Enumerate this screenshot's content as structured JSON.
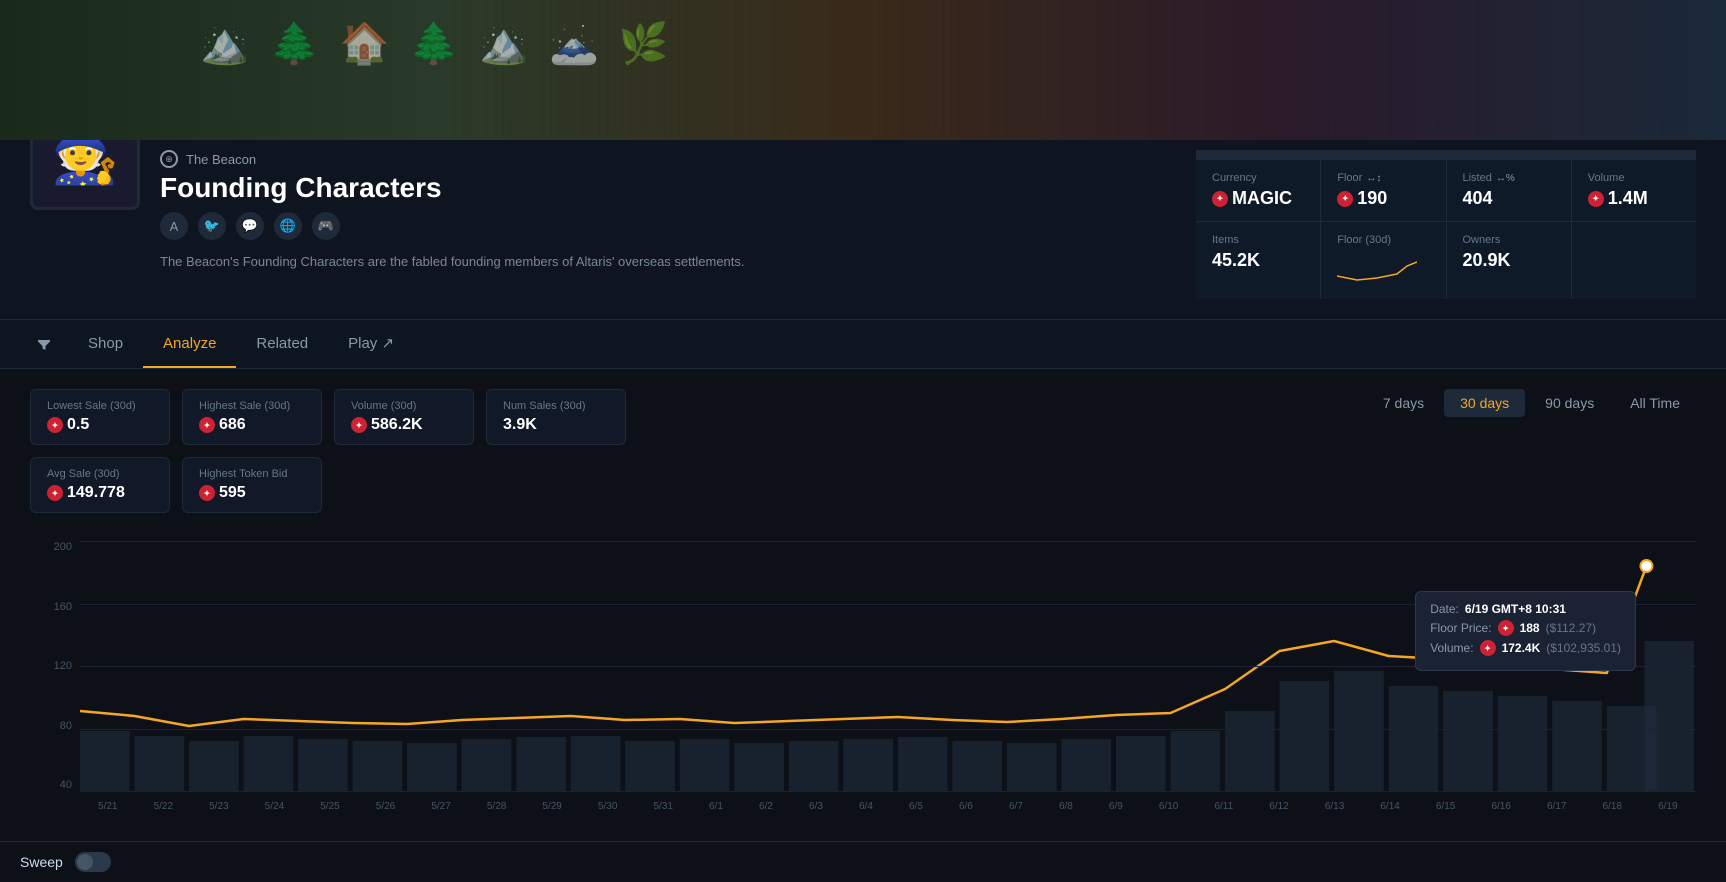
{
  "banner": {
    "emoji": "🏔️"
  },
  "collection": {
    "avatar_emoji": "🧙",
    "brand": "The Beacon",
    "title": "Founding Characters",
    "description": "The Beacon's Founding Characters are the fabled founding members of Altaris' overseas settlements.",
    "social_links": [
      "A",
      "🐦",
      "💬",
      "🌐",
      "🎮"
    ]
  },
  "stats": {
    "currency": {
      "label": "Currency",
      "value": "MAGIC"
    },
    "floor": {
      "label": "Floor",
      "value": "190",
      "arrows": "↔↕"
    },
    "listed": {
      "label": "Listed",
      "value": "404",
      "arrows": "↔%"
    },
    "volume": {
      "label": "Volume",
      "value": "1.4M"
    },
    "items": {
      "label": "Items",
      "value": "45.2K"
    },
    "floor_30d": {
      "label": "Floor (30d)"
    },
    "owners": {
      "label": "Owners",
      "value": "20.9K"
    }
  },
  "nav": {
    "filter_icon": "▼",
    "tabs": [
      {
        "label": "Shop",
        "active": false
      },
      {
        "label": "Analyze",
        "active": true
      },
      {
        "label": "Related",
        "active": false
      },
      {
        "label": "Play ↗",
        "active": false,
        "external": true
      }
    ]
  },
  "analyze": {
    "stats": [
      {
        "label": "Lowest Sale (30d)",
        "value": "0.5"
      },
      {
        "label": "Highest Sale (30d)",
        "value": "686"
      },
      {
        "label": "Volume (30d)",
        "value": "586.2K"
      },
      {
        "label": "Num Sales (30d)",
        "value": "3.9K"
      },
      {
        "label": "Avg Sale (30d)",
        "value": "149.778"
      },
      {
        "label": "Highest Token Bid",
        "value": "595"
      }
    ],
    "time_buttons": [
      {
        "label": "7 days",
        "active": false
      },
      {
        "label": "30 days",
        "active": true
      },
      {
        "label": "90 days",
        "active": false
      },
      {
        "label": "All Time",
        "active": false
      }
    ],
    "chart": {
      "y_labels": [
        "200",
        "160",
        "120",
        "80",
        "40"
      ],
      "x_labels": [
        "5/21",
        "5/22",
        "5/23",
        "5/24",
        "5/25",
        "5/26",
        "5/27",
        "5/28",
        "5/29",
        "5/30",
        "5/31",
        "6/1",
        "6/2",
        "6/3",
        "6/4",
        "6/5",
        "6/6",
        "6/7",
        "6/8",
        "6/9",
        "6/10",
        "6/11",
        "6/12",
        "6/13",
        "6/14",
        "6/15",
        "6/16",
        "6/17",
        "6/18",
        "6/19"
      ],
      "bars": [
        20,
        18,
        15,
        17,
        16,
        14,
        13,
        15,
        16,
        17,
        14,
        15,
        13,
        14,
        15,
        16,
        14,
        13,
        15,
        17,
        18,
        25,
        35,
        38,
        32,
        30,
        28,
        25,
        22,
        45
      ],
      "tooltip": {
        "date_label": "Date:",
        "date_value": "6/19 GMT+8 10:31",
        "floor_label": "Floor Price:",
        "floor_value": "188",
        "floor_usd": "($112.27)",
        "volume_label": "Volume:",
        "volume_value": "172.4K",
        "volume_usd": "($102,935.01)"
      }
    }
  },
  "sweep": {
    "label": "Sweep"
  }
}
